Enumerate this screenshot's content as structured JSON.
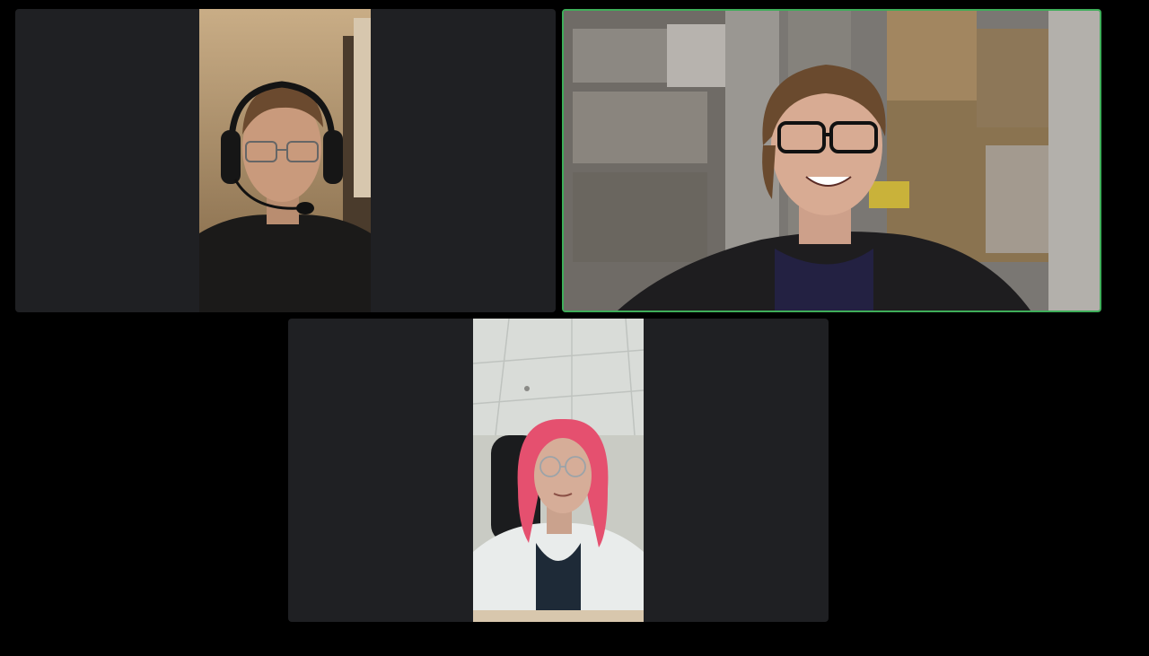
{
  "meeting": {
    "layout": "gallery",
    "participant_count": 3,
    "active_speaker_color": "#3fae5a"
  },
  "participants": [
    {
      "id": 1,
      "video": "on",
      "orientation": "portrait",
      "active_speaker": false
    },
    {
      "id": 2,
      "video": "on",
      "orientation": "landscape",
      "active_speaker": true
    },
    {
      "id": 3,
      "video": "on",
      "orientation": "portrait",
      "active_speaker": false
    }
  ]
}
